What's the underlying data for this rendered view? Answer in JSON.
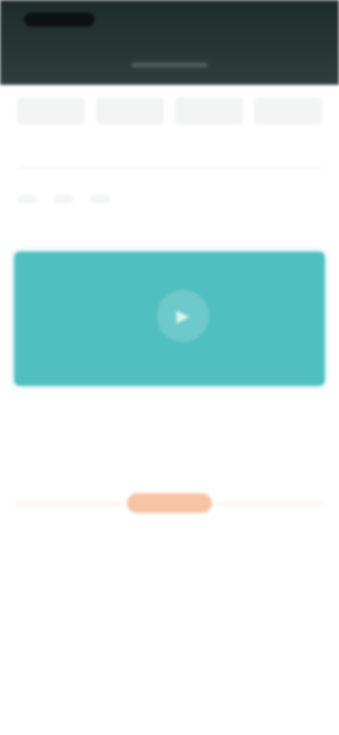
{
  "header": {
    "status_time": "",
    "status_right": "",
    "title": ""
  },
  "tabs": [
    {
      "label": ""
    },
    {
      "label": ""
    },
    {
      "label": ""
    },
    {
      "label": ""
    }
  ],
  "subtitle": "",
  "filters": [
    {
      "label": ""
    },
    {
      "label": ""
    },
    {
      "label": ""
    }
  ],
  "media": {
    "play_icon": "play-icon",
    "color": "#4fbfbf"
  },
  "info": {
    "title": "",
    "lines": [
      "",
      "",
      ""
    ]
  },
  "action": {
    "label": "",
    "color": "#f6c3a5"
  }
}
